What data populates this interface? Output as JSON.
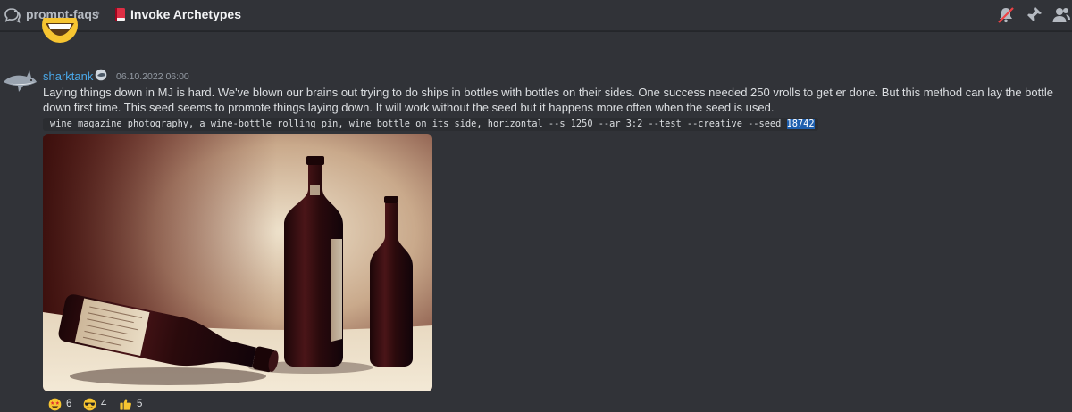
{
  "header": {
    "parent_channel": "prompt-faqs",
    "separator": "›",
    "thread_title": "Invoke Archetypes"
  },
  "message": {
    "author": "sharktank",
    "timestamp": "06.10.2022 06:00",
    "text": "Laying things down in MJ is hard. We've blown our brains out trying to do ships in bottles with bottles on their sides. One success needed 250 vrolls to get er done. But this method can lay the bottle down first time. This seed seems to promote things laying down. It will work without the seed but it happens more often when the seed is used.",
    "code_prefix": "wine magazine photography, a wine-bottle rolling pin, wine bottle on its side, horizontal --s 1250 --ar 3:2 --test --creative --seed ",
    "code_selected": "18742"
  },
  "reactions": [
    {
      "icon": "star-struck-emoji-icon",
      "count": "6"
    },
    {
      "icon": "sunglasses-emoji-icon",
      "count": "4"
    },
    {
      "icon": "thumbs-up-emoji-icon",
      "count": "5"
    }
  ],
  "colors": {
    "background": "#313338",
    "username": "#4aa8e8",
    "selection": "#1e5fae"
  }
}
